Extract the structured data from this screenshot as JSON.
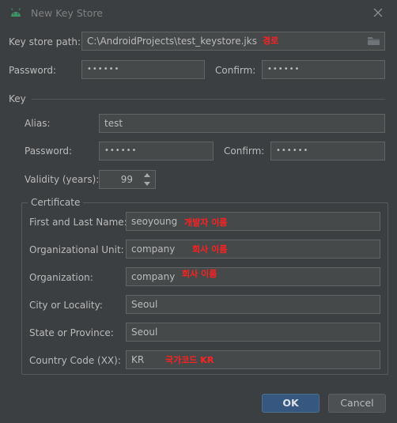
{
  "window": {
    "title": "New Key Store",
    "icon": "android-icon",
    "close_icon": "close-icon"
  },
  "keystore": {
    "path_label": "Key store path:",
    "path_value": "C:\\AndroidProjects\\test_keystore.jks",
    "path_note": "경로",
    "password_label": "Password:",
    "password_value": "••••••",
    "confirm_label": "Confirm:",
    "confirm_value": "••••••"
  },
  "key": {
    "section_label": "Key",
    "alias_label": "Alias:",
    "alias_value": "test",
    "password_label": "Password:",
    "password_value": "••••••",
    "confirm_label": "Confirm:",
    "confirm_value": "••••••",
    "validity_label": "Validity (years):",
    "validity_value": "99"
  },
  "certificate": {
    "legend": "Certificate",
    "fields": [
      {
        "label": "First and Last Name:",
        "value": "seoyoung",
        "note": "개발자 이름"
      },
      {
        "label": "Organizational Unit:",
        "value": "company",
        "note": "회사 이름"
      },
      {
        "label": "Organization:",
        "value": "company",
        "note": "회사 이름"
      },
      {
        "label": "City or Locality:",
        "value": "Seoul",
        "note": ""
      },
      {
        "label": "State or Province:",
        "value": "Seoul",
        "note": ""
      },
      {
        "label": "Country Code (XX):",
        "value": "KR",
        "note": "국가코드 KR"
      }
    ]
  },
  "buttons": {
    "ok": "OK",
    "cancel": "Cancel"
  },
  "colors": {
    "background": "#3c3f41",
    "field_bg": "#45494a",
    "annotation": "#ff2020",
    "primary_button": "#365880"
  }
}
